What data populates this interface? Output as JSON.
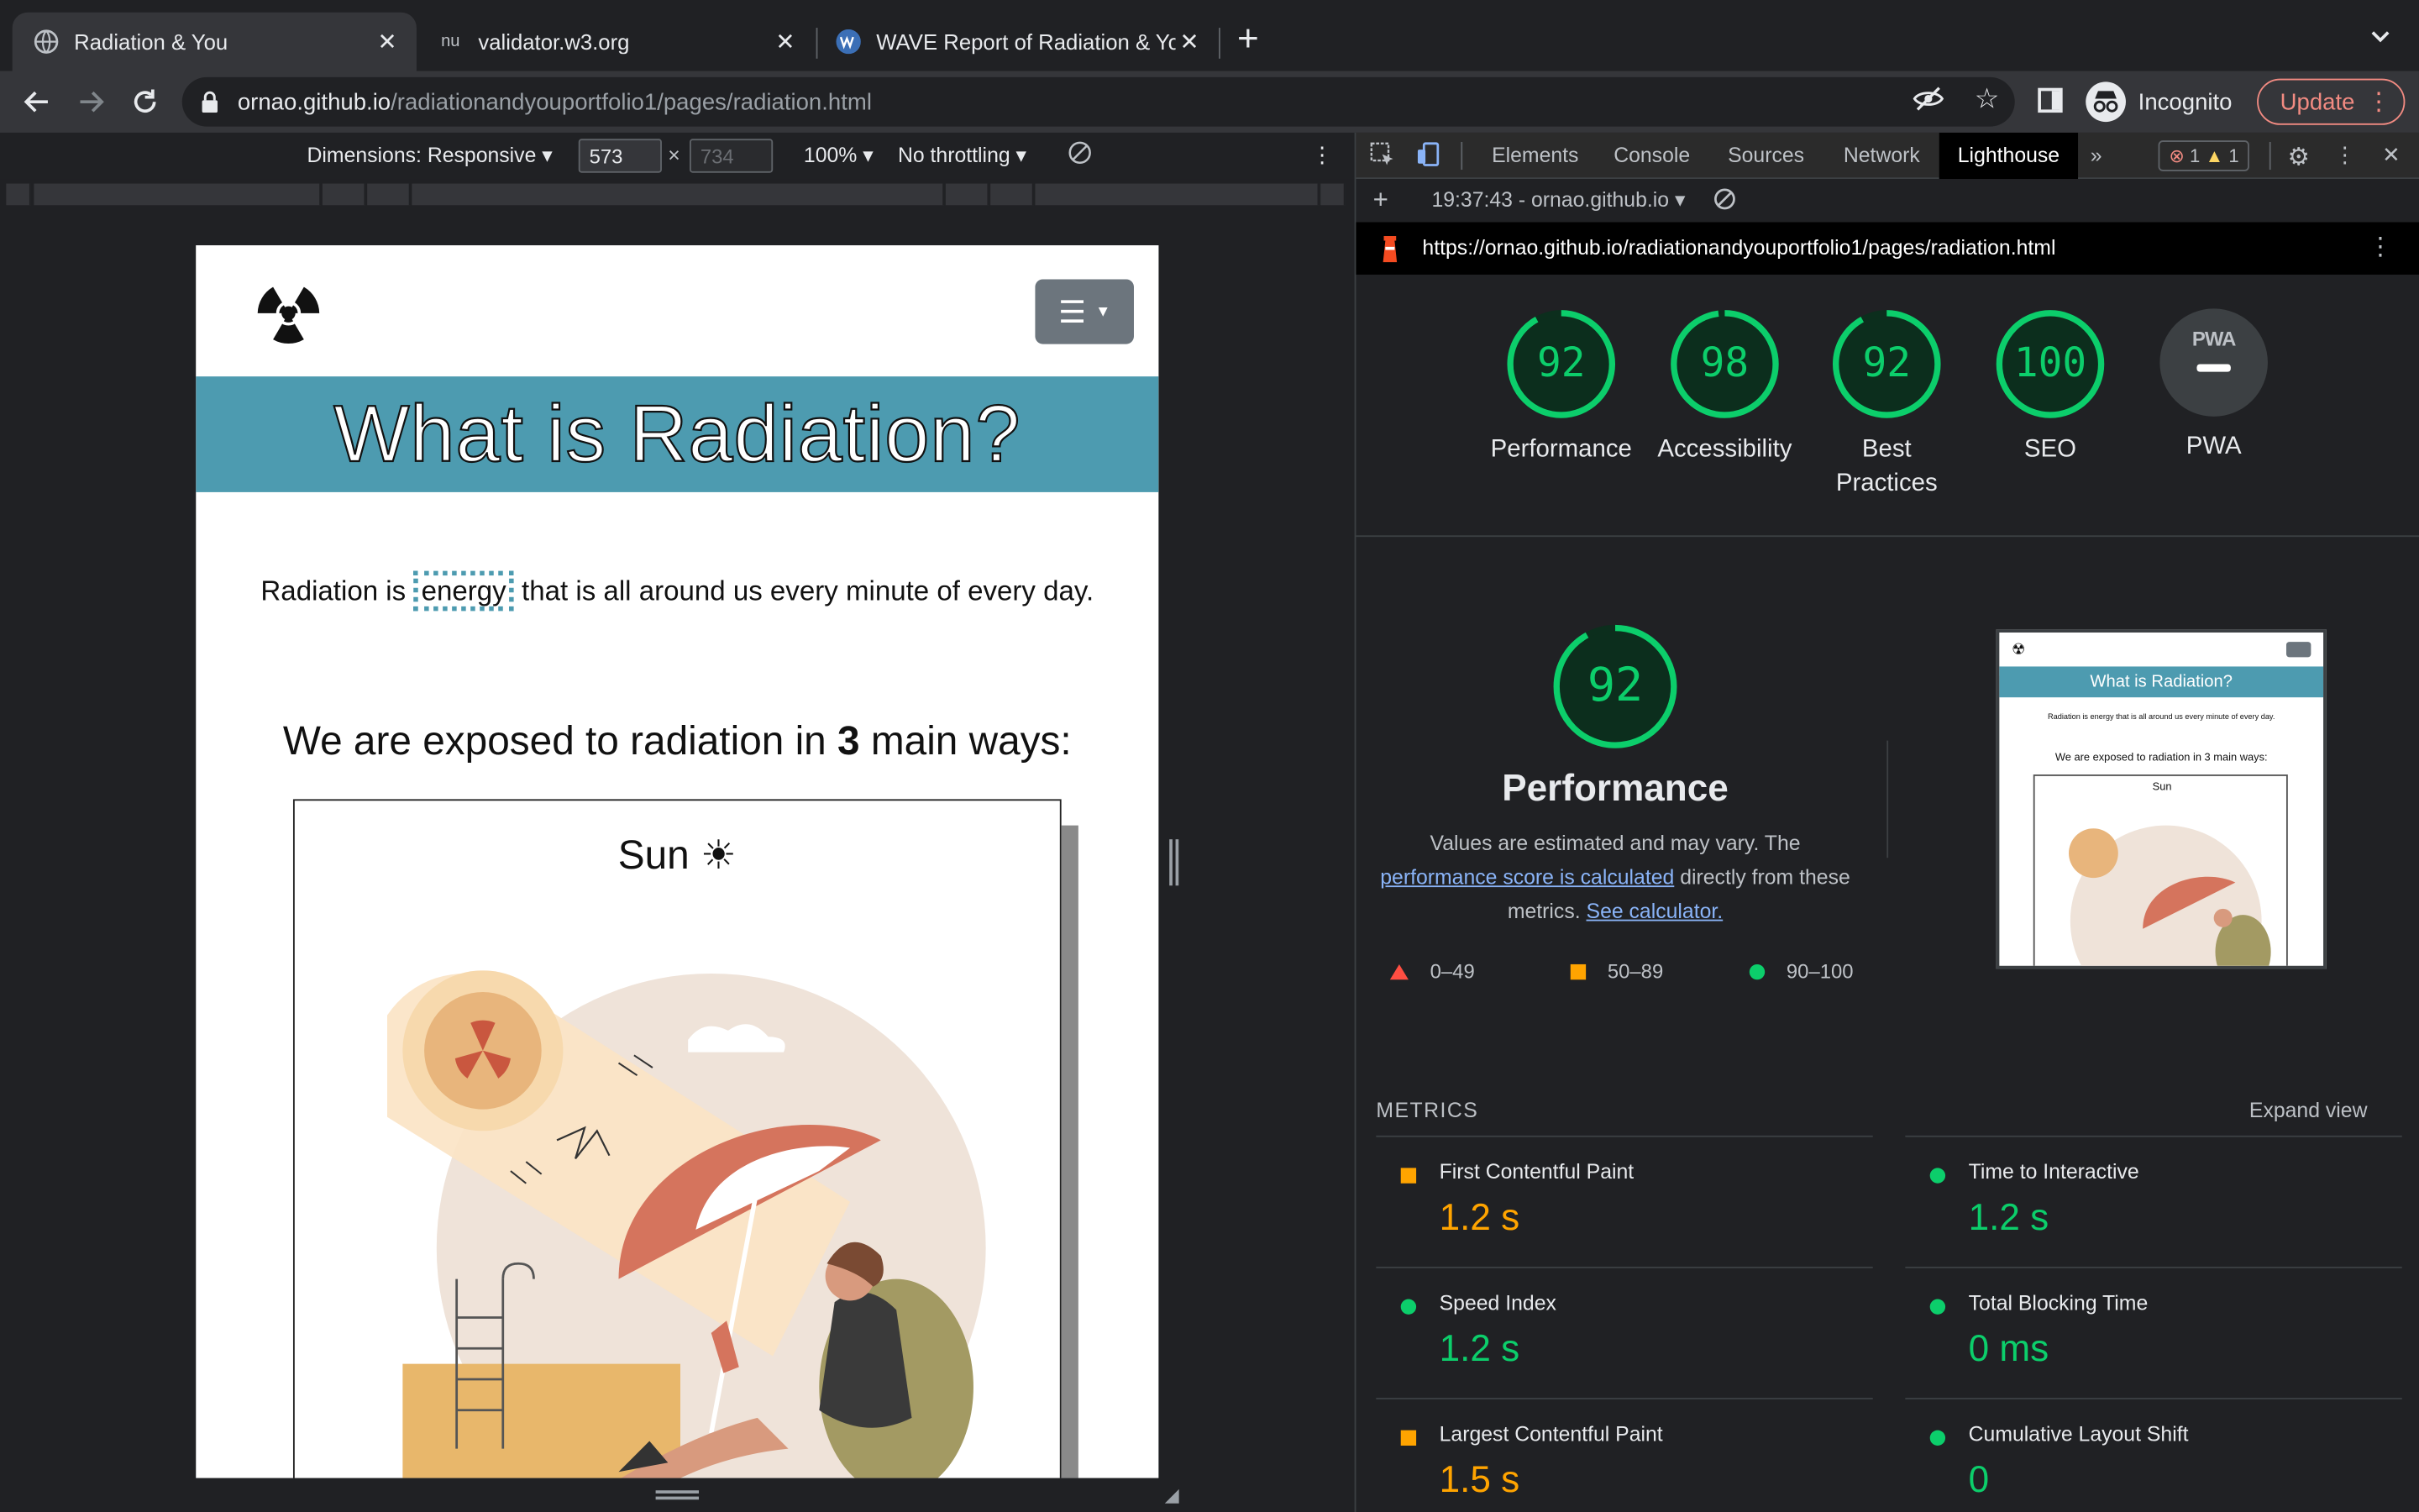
{
  "browser": {
    "tabs": [
      {
        "title": "Radiation & You",
        "favicon": "globe-icon"
      },
      {
        "title": "validator.w3.org",
        "favicon": "w3c-validator-icon"
      },
      {
        "title": "WAVE Report of Radiation & Yo",
        "favicon": "wave-icon"
      }
    ],
    "url_host": "ornao.github.io",
    "url_path": "/radiationandyouportfolio1/pages/radiation.html",
    "profile_label": "Incognito",
    "update_label": "Update"
  },
  "device_toolbar": {
    "dimensions_label": "Dimensions: Responsive",
    "width": "573",
    "height": "734",
    "times": "×",
    "zoom": "100%",
    "throttling": "No throttling"
  },
  "page": {
    "hero_title": "What is Radiation?",
    "intro_before": "Radiation is ",
    "intro_highlight": "energy",
    "intro_after": " that is all around us every minute of every day.",
    "ways_before": "We are exposed to radiation in ",
    "ways_number": "3",
    "ways_after": " main ways:",
    "card_title": "Sun",
    "sun_glyph": "☀"
  },
  "devtools": {
    "tabs": [
      "Elements",
      "Console",
      "Sources",
      "Network",
      "Lighthouse"
    ],
    "active_tab": "Lighthouse",
    "errors": "1",
    "warnings": "1",
    "report_time": "19:37:43 - ornao.github.io",
    "report_url": "https://ornao.github.io/radiationandyouportfolio1/pages/radiation.html",
    "gauges": [
      {
        "score": "92",
        "label": "Performance"
      },
      {
        "score": "98",
        "label": "Accessibility"
      },
      {
        "score": "92",
        "label": "Best Practices"
      },
      {
        "score": "100",
        "label": "SEO"
      },
      {
        "score": "",
        "label": "PWA",
        "badge": "PWA"
      }
    ],
    "performance": {
      "score": "92",
      "title": "Performance",
      "desc_prefix": "Values are estimated and may vary. The ",
      "desc_link1": "performance score is calculated",
      "desc_middle": " directly from these metrics. ",
      "desc_link2": "See calculator.",
      "legend": [
        "0–49",
        "50–89",
        "90–100"
      ],
      "thumb_title": "What is Radiation?",
      "thumb_intro": "Radiation is energy that is all around us every minute of every day.",
      "thumb_ways": "We are exposed to radiation in 3 main ways:",
      "thumb_card": "Sun"
    },
    "metrics_heading": "METRICS",
    "expand_label": "Expand view",
    "metrics": [
      {
        "label": "First Contentful Paint",
        "value": "1.2 s",
        "status": "orange"
      },
      {
        "label": "Time to Interactive",
        "value": "1.2 s",
        "status": "green"
      },
      {
        "label": "Speed Index",
        "value": "1.2 s",
        "status": "green"
      },
      {
        "label": "Total Blocking Time",
        "value": "0 ms",
        "status": "green"
      },
      {
        "label": "Largest Contentful Paint",
        "value": "1.5 s",
        "status": "orange"
      },
      {
        "label": "Cumulative Layout Shift",
        "value": "0",
        "status": "green"
      }
    ]
  },
  "colors": {
    "score_green": "#0cce6b",
    "score_orange": "#ffa400",
    "score_red": "#ff4e42",
    "hero_teal": "#4d9bb0"
  }
}
